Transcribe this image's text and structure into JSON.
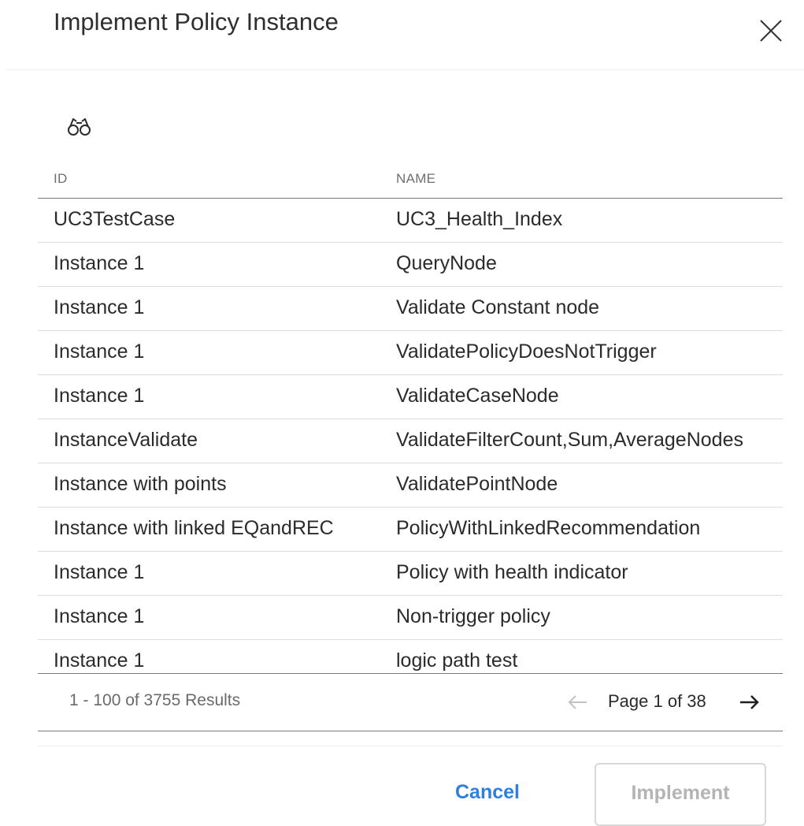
{
  "dialog": {
    "title": "Implement Policy Instance"
  },
  "grid": {
    "columns": [
      "ID",
      "NAME"
    ],
    "rows": [
      {
        "id": "UC3TestCase",
        "name": "UC3_Health_Index"
      },
      {
        "id": "Instance 1",
        "name": "QueryNode"
      },
      {
        "id": "Instance 1",
        "name": "Validate Constant node"
      },
      {
        "id": "Instance 1",
        "name": "ValidatePolicyDoesNotTrigger"
      },
      {
        "id": "Instance 1",
        "name": "ValidateCaseNode"
      },
      {
        "id": "InstanceValidate",
        "name": "ValidateFilterCount,Sum,AverageNodes"
      },
      {
        "id": "Instance with points",
        "name": "ValidatePointNode"
      },
      {
        "id": "Instance with linked EQandREC",
        "name": "PolicyWithLinkedRecommendation"
      },
      {
        "id": "Instance 1",
        "name": "Policy with health indicator"
      },
      {
        "id": "Instance 1",
        "name": "Non-trigger policy"
      },
      {
        "id": "Instance 1",
        "name": "logic path test"
      }
    ]
  },
  "pagination": {
    "results_text": "1 - 100 of 3755 Results",
    "page_text": "Page 1 of 38"
  },
  "actions": {
    "cancel_label": "Cancel",
    "implement_label": "Implement"
  },
  "icons": {
    "close": "close-icon",
    "search": "binoculars-icon",
    "prev": "arrow-left-icon",
    "next": "arrow-right-icon"
  },
  "colors": {
    "accent": "#2e7fe0",
    "disabled_text": "#b4b4b4",
    "title_text": "#2f2f2f"
  }
}
